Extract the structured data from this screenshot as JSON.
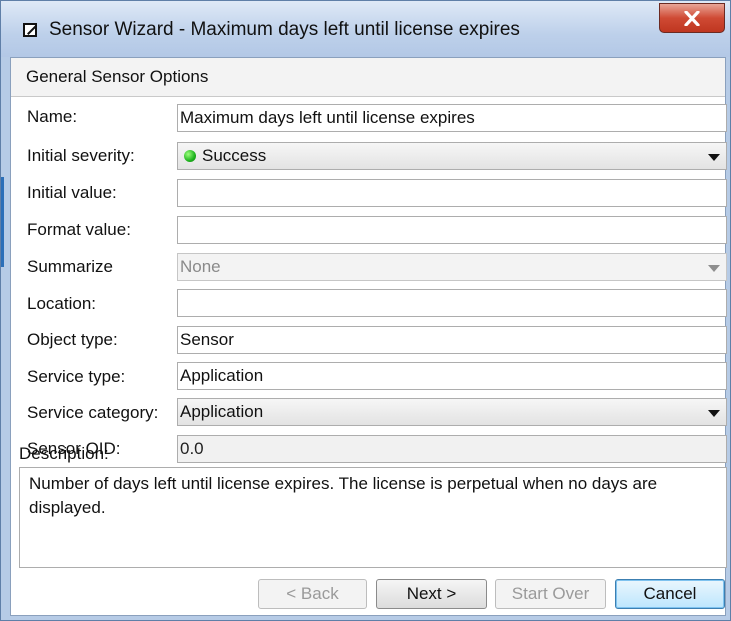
{
  "window": {
    "title": "Sensor Wizard - Maximum days left until license expires"
  },
  "section": {
    "header": "General Sensor Options"
  },
  "form": {
    "name": {
      "label": "Name:",
      "value": "Maximum days left until license expires"
    },
    "initial_severity": {
      "label": "Initial severity:",
      "value": "Success",
      "status_color": "#1eb31e"
    },
    "initial_value": {
      "label": "Initial value:",
      "value": ""
    },
    "format_value": {
      "label": "Format value:",
      "value": ""
    },
    "summarize": {
      "label": "Summarize",
      "value": "None"
    },
    "location": {
      "label": "Location:",
      "value": ""
    },
    "object_type": {
      "label": "Object type:",
      "value": "Sensor"
    },
    "service_type": {
      "label": "Service type:",
      "value": "Application"
    },
    "service_category": {
      "label": "Service category:",
      "value": "Application"
    },
    "sensor_oid": {
      "label": "Sensor OID:",
      "value": "0.0"
    },
    "description": {
      "label": "Description:",
      "value": "Number of days left until license expires. The license is perpetual when no days are displayed."
    }
  },
  "buttons": {
    "back": "< Back",
    "next": "Next >",
    "start_over": "Start Over",
    "cancel": "Cancel"
  },
  "colors": {
    "title_bar": "#bdd0ea",
    "close_button": "#cf4a34",
    "default_button": "#bde6fd"
  }
}
